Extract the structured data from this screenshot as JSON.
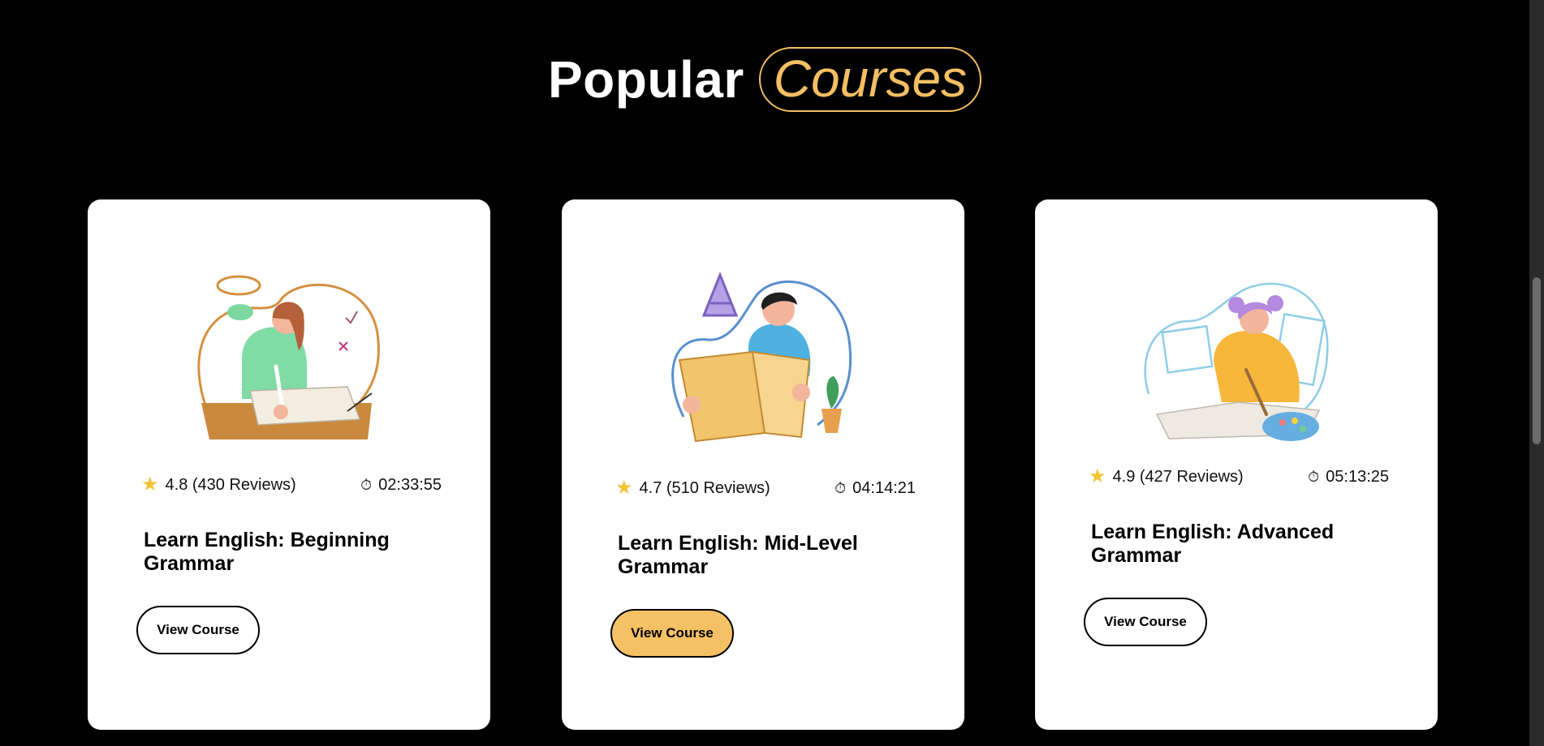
{
  "heading": {
    "main": "Popular",
    "highlight": "Courses"
  },
  "colors": {
    "background": "#000000",
    "accent": "#f4be62",
    "card": "#ffffff",
    "active_button": "#f6c165"
  },
  "courses": [
    {
      "illustration": "girl-writing-math-illustration",
      "rating": "4.8 (430 Reviews)",
      "duration": "02:33:55",
      "title": "Learn English: Beginning Grammar",
      "button": "View Course",
      "button_active": false
    },
    {
      "illustration": "boy-reading-book-illustration",
      "rating": "4.7 (510 Reviews)",
      "duration": "04:14:21",
      "title": "Learn English: Mid-Level Grammar",
      "button": "View Course",
      "button_active": true
    },
    {
      "illustration": "girl-painting-illustration",
      "rating": "4.9 (427 Reviews)",
      "duration": "05:13:25",
      "title": "Learn English: Advanced Grammar",
      "button": "View Course",
      "button_active": false
    }
  ]
}
